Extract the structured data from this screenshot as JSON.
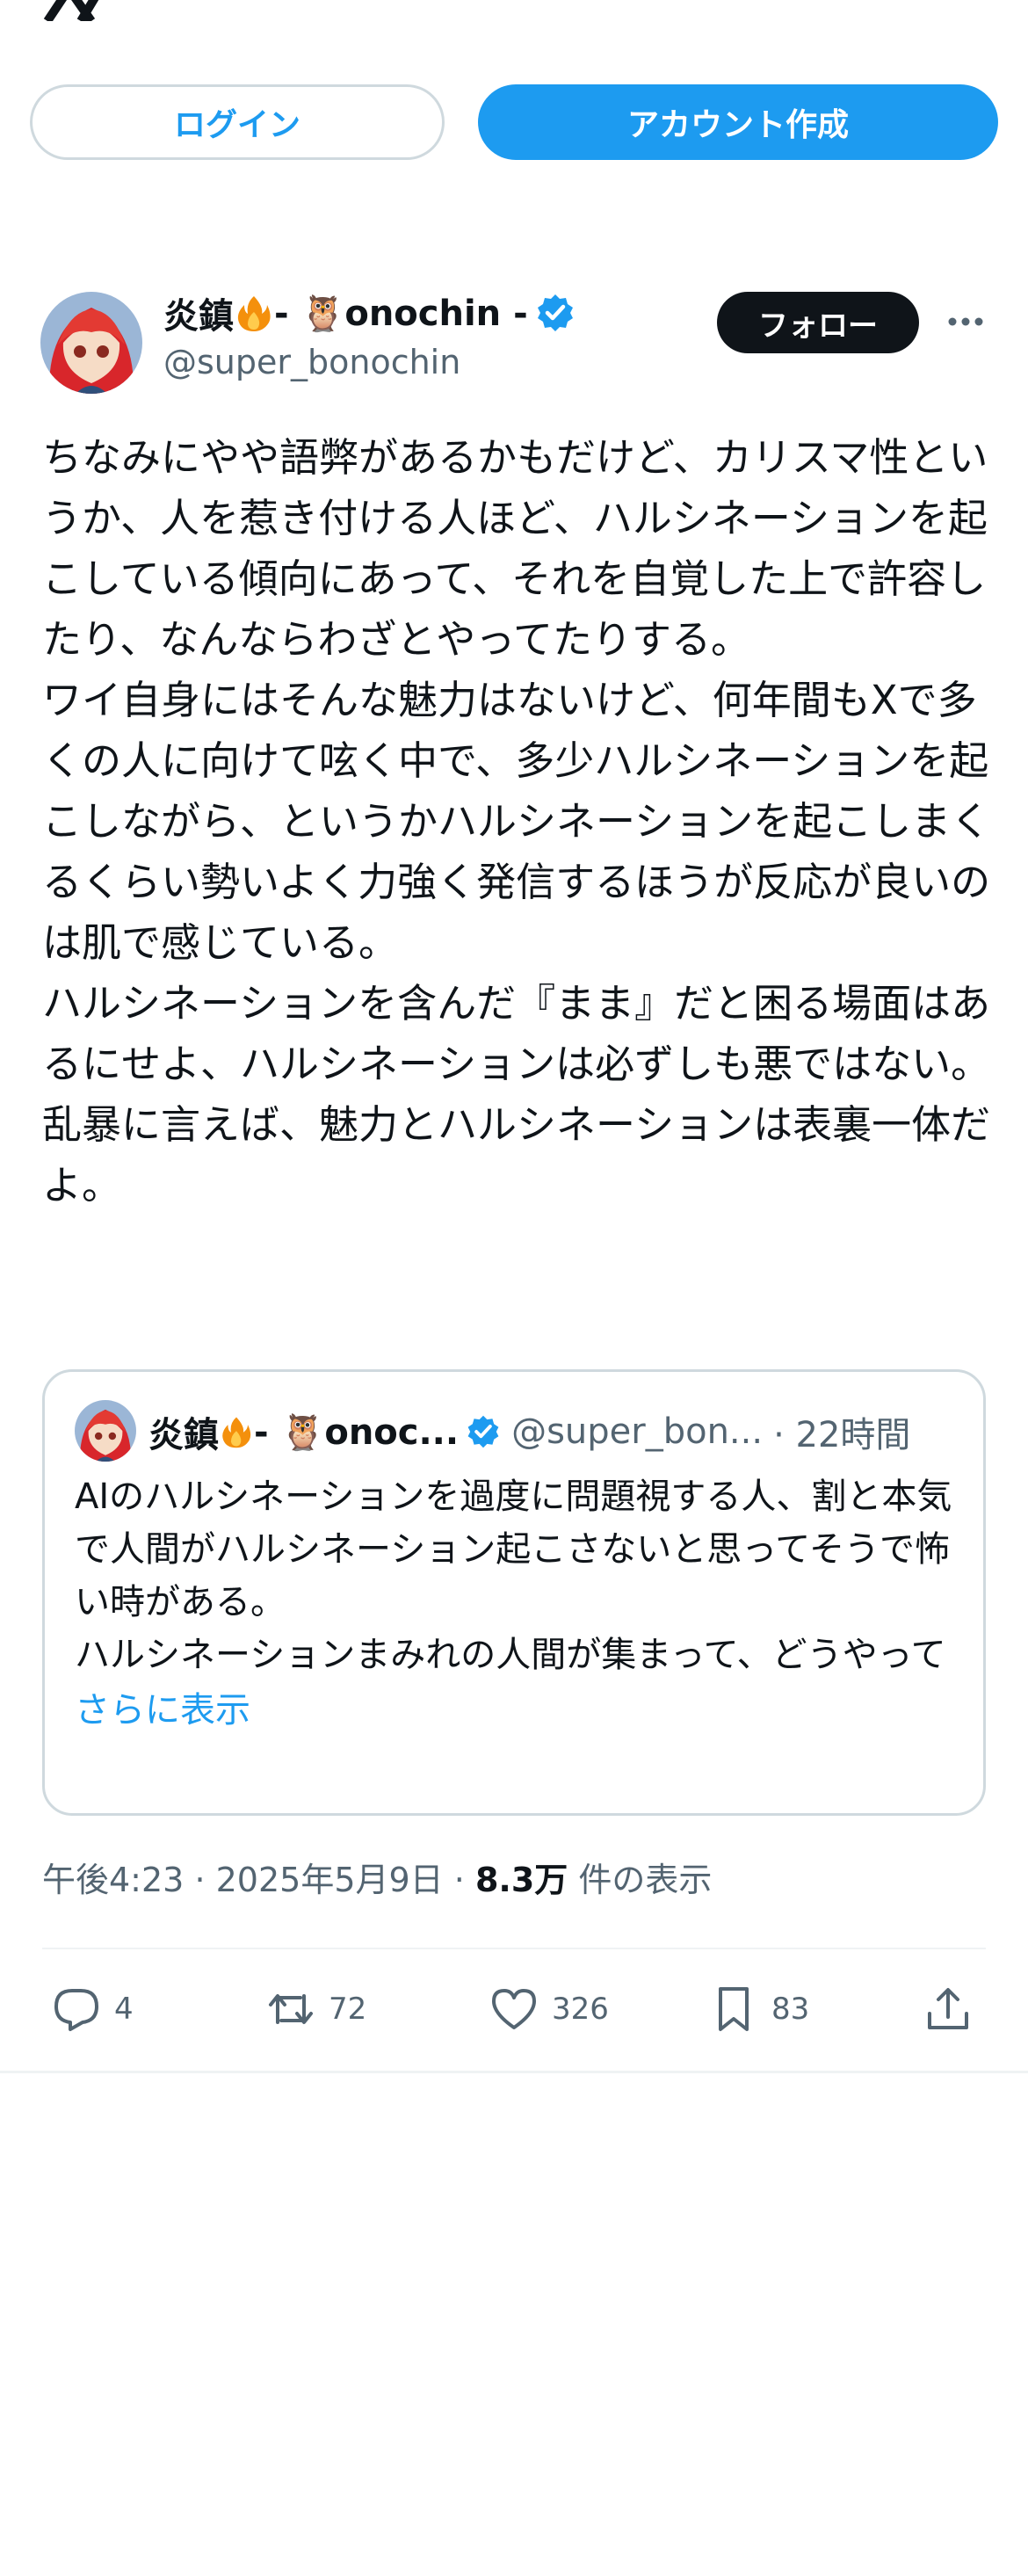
{
  "header": {
    "logo_icon": "x-logo-icon",
    "login_label": "ログイン",
    "signup_label": "アカウント作成"
  },
  "tweet": {
    "author_name_prefix": "炎鎮",
    "author_name_suffix": " - 🦉onochin - ",
    "handle": "@super_bonochin",
    "follow_label": "フォロー",
    "body": "ちなみにやや語弊があるかもだけど、カリスマ性というか、人を惹き付ける人ほど、ハルシネーションを起こしている傾向にあって、それを自覚した上で許容したり、なんならわざとやってたりする。\nワイ自身にはそんな魅力はないけど、何年間もXで多くの人に向けて呟く中で、多少ハルシネーションを起こしながら、というかハルシネーションを起こしまくるくらい勢いよく力強く発信するほうが反応が良いのは肌で感じている。\nハルシネーションを含んだ『まま』だと困る場面はあるにせよ、ハルシネーションは必ずしも悪ではない。\n乱暴に言えば、魅力とハルシネーションは表裏一体だよ。",
    "time": "午後4:23",
    "date": "2025年5月9日",
    "views_count": "8.3万",
    "views_label": "件の表示"
  },
  "quote": {
    "author_name_prefix": "炎鎮",
    "author_name_suffix": " - 🦉onoc...",
    "handle": "@super_bon...",
    "time": "· 22時間",
    "body": "AIのハルシネーションを過度に問題視する人、割と本気で人間がハルシネーション起こさないと思ってそうで怖い時がある。\nハルシネーションまみれの人間が集まって、どうやって会社や組織が回っているか、それを考えたら、ハ...",
    "show_more": "さらに表示"
  },
  "actions": {
    "replies": "4",
    "retweets": "72",
    "likes": "326",
    "bookmarks": "83"
  },
  "colors": {
    "accent": "#1d9bf0",
    "text": "#0f1419",
    "muted": "#536471",
    "border": "#cfd9de"
  }
}
